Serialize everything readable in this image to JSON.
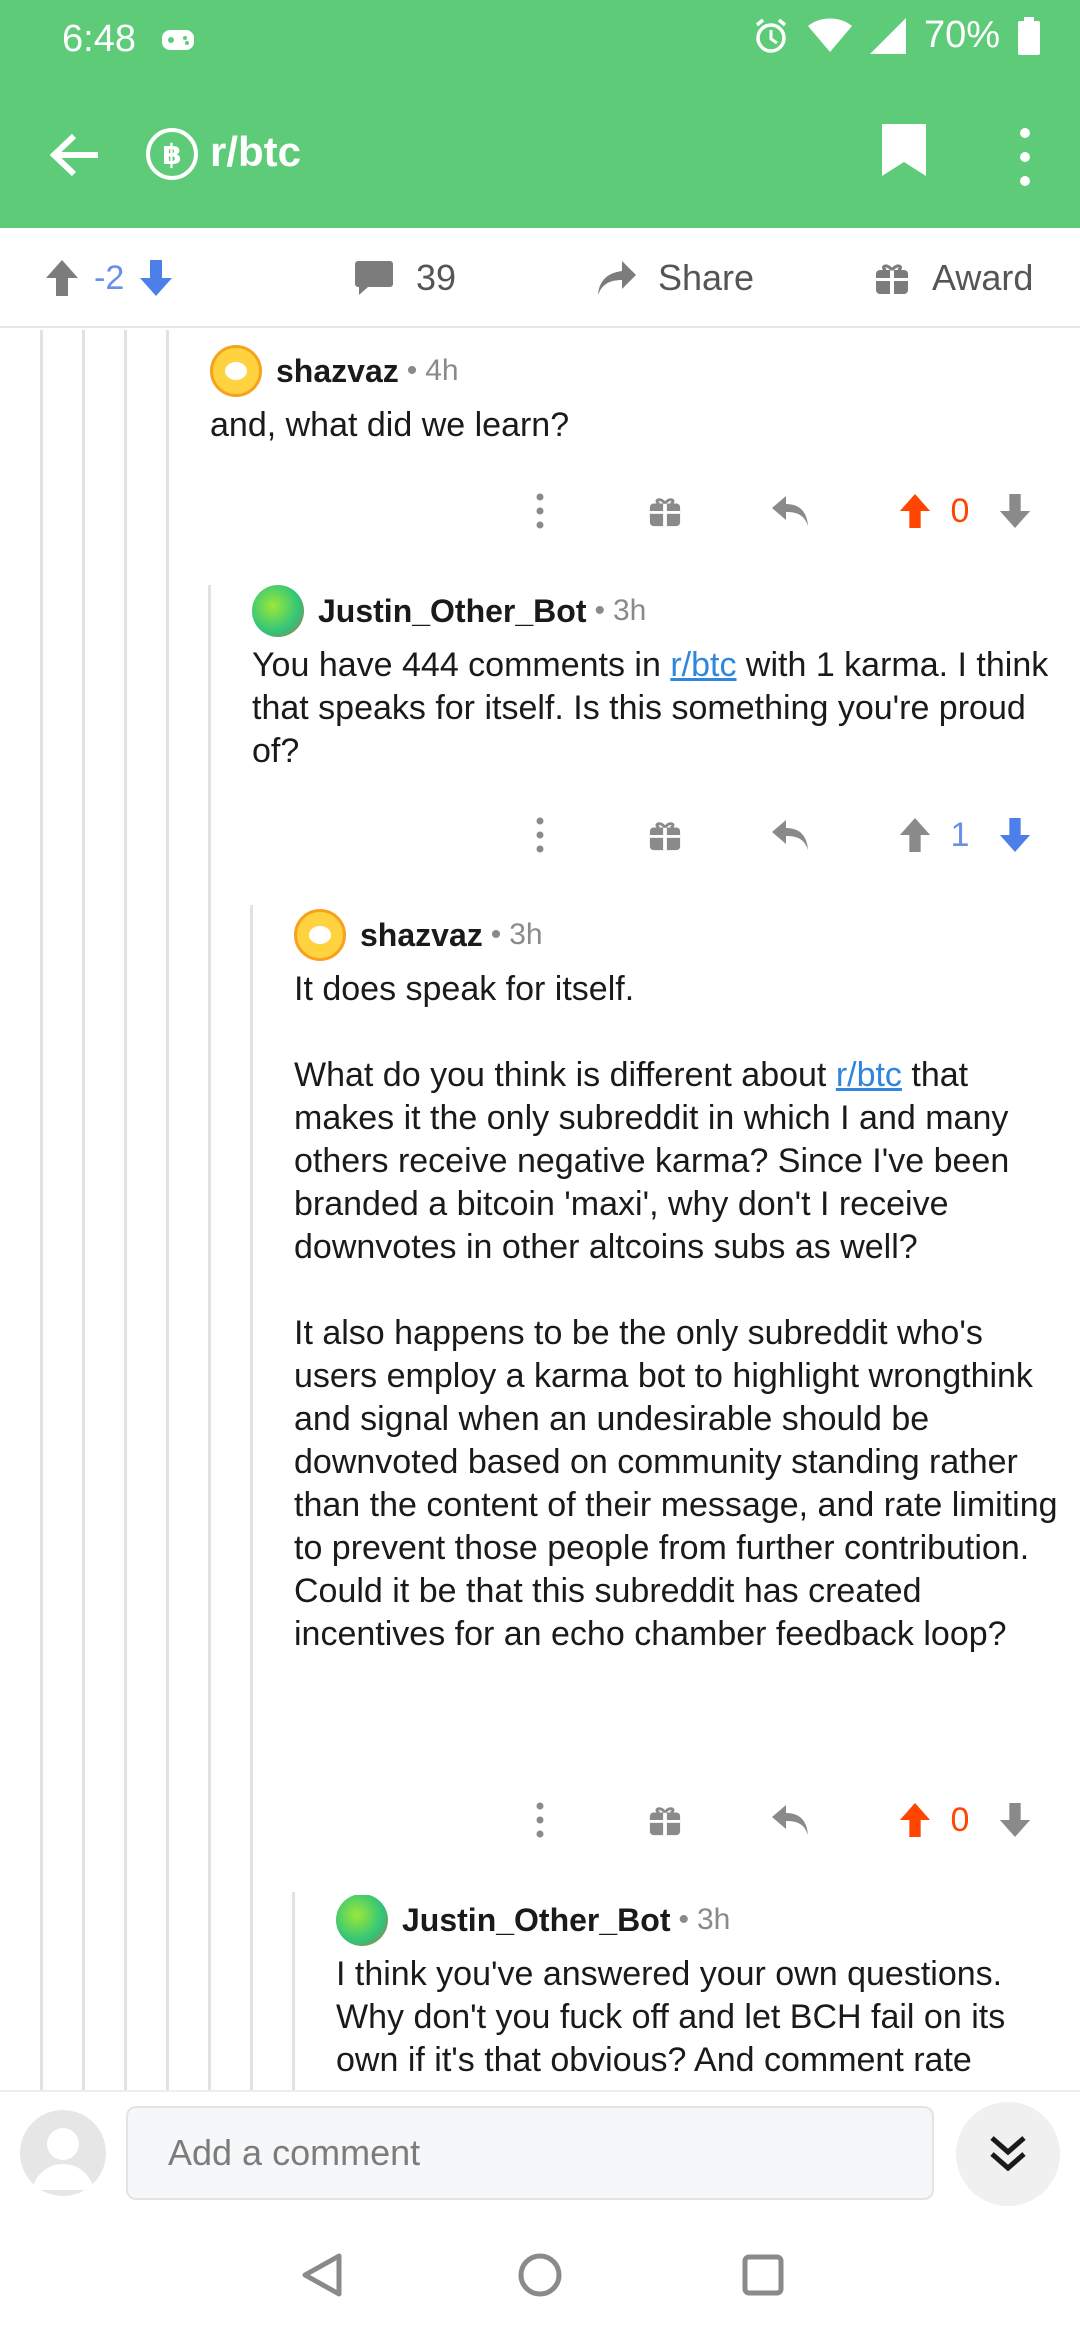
{
  "status": {
    "time": "6:48",
    "battery": "70%"
  },
  "header": {
    "title": "r/btc",
    "sub_icon": "bitcoin-icon"
  },
  "post_actions": {
    "score": "-2",
    "comments": "39",
    "share": "Share",
    "award": "Award"
  },
  "comments": [
    {
      "author": "shazvaz",
      "time": "4h",
      "body": [
        "and, what did we learn?"
      ],
      "score": "0"
    },
    {
      "author": "Justin_Other_Bot",
      "time": "3h",
      "body_pre": "You have 444 comments in ",
      "body_link": "r/btc",
      "body_post": " with 1 karma. I think that speaks for itself. Is this something you're proud of?",
      "score": "1"
    },
    {
      "author": "shazvaz",
      "time": "3h",
      "p1": "It does speak for itself.",
      "p2_pre": "What do you think is different about ",
      "p2_link": "r/btc",
      "p2_post": " that makes it the only subreddit in which I and many others receive negative karma? Since I've been branded a bitcoin 'maxi', why don't I receive downvotes in other altcoins subs as well?",
      "p3": "It also happens to be the only subreddit who's users employ a karma bot to highlight wrongthink and signal when an undesirable should be downvoted based on community standing rather than the content of their message, and rate limiting to prevent those people from further contribution. Could it be that this subreddit has created incentives for an echo chamber feedback loop?",
      "score": "0"
    },
    {
      "author": "Justin_Other_Bot",
      "time": "3h",
      "body": "I think you've answered your own questions. Why don't you fuck off and let BCH fail on its own if it's that obvious? And comment rate"
    }
  ],
  "comment_box": {
    "placeholder": "Add a comment"
  },
  "sep": "•"
}
